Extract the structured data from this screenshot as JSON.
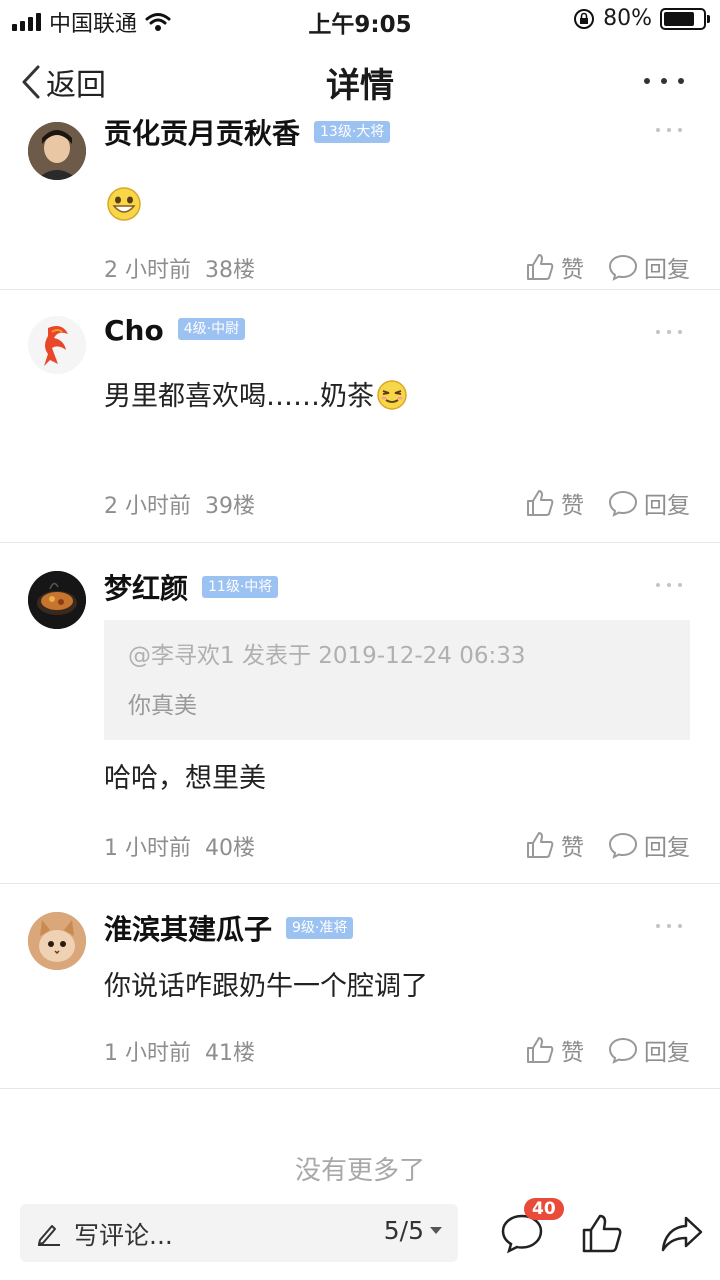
{
  "status_bar": {
    "carrier": "中国联通",
    "time": "上午9:05",
    "battery": "80%",
    "battery_level": 0.8
  },
  "nav": {
    "back_label": "返回",
    "title": "详情"
  },
  "comments": [
    {
      "username": "贡化贡月贡秋香",
      "level": "13级·大将",
      "content": "",
      "emoji": "grin",
      "time": "2 小时前",
      "floor": "38楼",
      "like_label": "赞",
      "reply_label": "回复"
    },
    {
      "username": "Cho",
      "level": "4级·中尉",
      "content": "男里都喜欢喝……奶茶",
      "emoji": "smirk",
      "time": "2 小时前",
      "floor": "39楼",
      "like_label": "赞",
      "reply_label": "回复"
    },
    {
      "username": "梦红颜",
      "level": "11级·中将",
      "quote_header": "@李寻欢1 发表于 2019-12-24 06:33",
      "quote_body": "你真美",
      "content": "哈哈，想里美",
      "time": "1 小时前",
      "floor": "40楼",
      "like_label": "赞",
      "reply_label": "回复"
    },
    {
      "username": "淮滨其建瓜子",
      "level": "9级·准将",
      "content": "你说话咋跟奶牛一个腔调了",
      "time": "1 小时前",
      "floor": "41楼",
      "like_label": "赞",
      "reply_label": "回复"
    }
  ],
  "footer": {
    "no_more": "没有更多了"
  },
  "bottom_bar": {
    "placeholder": "写评论...",
    "page": "5/5",
    "comment_count": "40"
  }
}
